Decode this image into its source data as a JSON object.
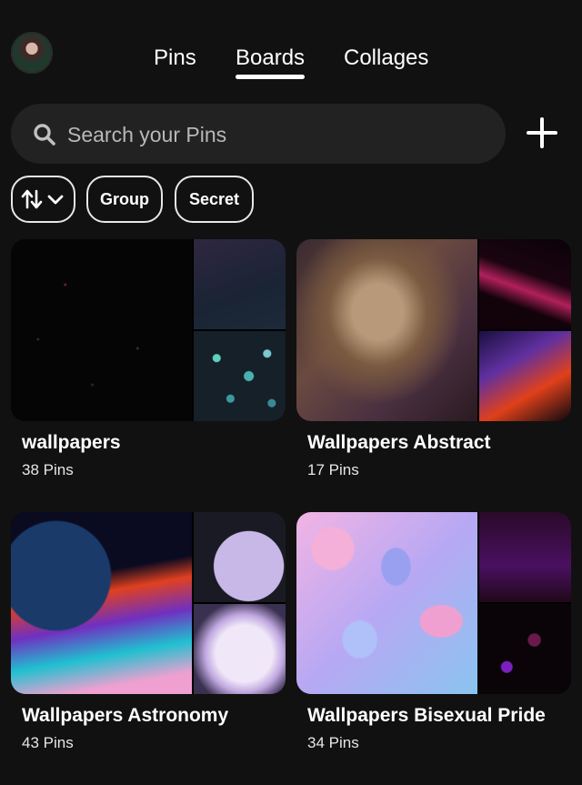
{
  "tabs": [
    {
      "label": "Pins"
    },
    {
      "label": "Boards"
    },
    {
      "label": "Collages"
    }
  ],
  "active_tab": "Boards",
  "search": {
    "placeholder": "Search your Pins"
  },
  "filters": {
    "sort_icon": "sort-arrows-icon",
    "chips": [
      {
        "label": "Group"
      },
      {
        "label": "Secret"
      }
    ]
  },
  "boards": [
    {
      "title": "wallpapers",
      "count": "38 Pins"
    },
    {
      "title": "Wallpapers Abstract",
      "count": "17 Pins"
    },
    {
      "title": "Wallpapers Astronomy",
      "count": "43 Pins"
    },
    {
      "title": "Wallpapers Bisexual Pride",
      "count": "34 Pins"
    }
  ],
  "colors": {
    "background": "#111111",
    "surface": "#222222",
    "text": "#ffffff"
  }
}
